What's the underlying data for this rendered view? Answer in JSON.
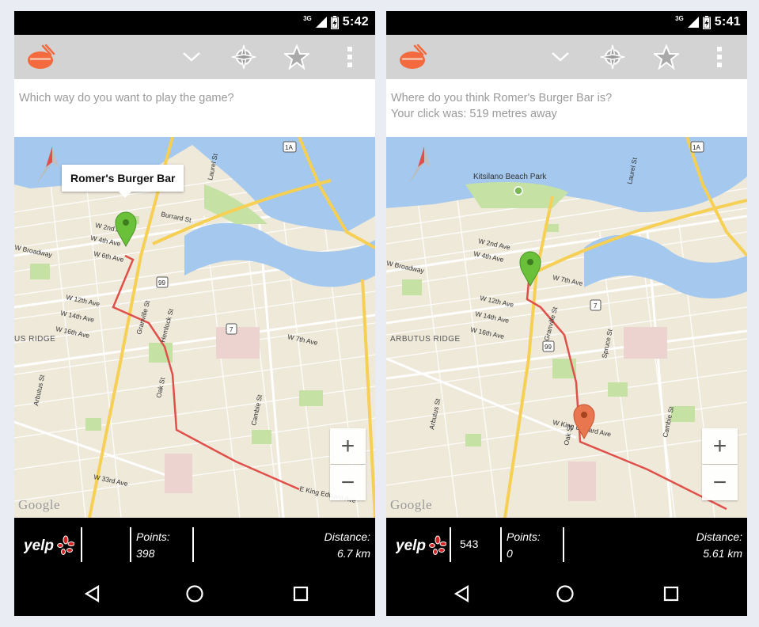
{
  "left": {
    "status": {
      "network": "3G",
      "time": "5:42"
    },
    "prompt": {
      "line1": "Which way do you want to play the game?",
      "line2": ""
    },
    "map": {
      "popup": "Romer's Burger Bar",
      "streets": [
        "W 2nd Ave",
        "W 4th Ave",
        "W 6th Ave",
        "W Broadway",
        "W 12th Ave",
        "W 14th Ave",
        "W 16th Ave",
        "Granville St",
        "Hemlock St",
        "W 7th Ave",
        "W 33rd Ave",
        "E King Edward Ave",
        "Cambie St",
        "Oak St",
        "Burrard St",
        "Arbutus St",
        "Laurel St"
      ],
      "area": "US RIDGE",
      "highways": [
        "99",
        "7",
        "1A"
      ],
      "google": "Google"
    },
    "bottom": {
      "rating": "",
      "points_label": "Points:",
      "points_value": "398",
      "distance_label": "Distance:",
      "distance_value": "6.7 km"
    }
  },
  "right": {
    "status": {
      "network": "3G",
      "time": "5:41"
    },
    "prompt": {
      "line1": "Where do you think Romer's Burger Bar is?",
      "line2": "Your click was: 519 metres away"
    },
    "map": {
      "park": "Kitsilano Beach Park",
      "streets": [
        "W 2nd Ave",
        "W 4th Ave",
        "W Broadway",
        "W 7th Ave",
        "W 12th Ave",
        "W 14th Ave",
        "W 16th Ave",
        "Granville St",
        "Spruce St",
        "W King Edward Ave",
        "Cambie St",
        "Oak St",
        "Arbutus St",
        "Laurel St"
      ],
      "area": "ARBUTUS RIDGE",
      "highways": [
        "99",
        "7",
        "1A"
      ],
      "google": "Google"
    },
    "bottom": {
      "rating": "543",
      "points_label": "Points:",
      "points_value": "0",
      "distance_label": "Distance:",
      "distance_value": "5.61 km"
    }
  },
  "icons": [
    "app-logo-icon",
    "chevron-down-icon",
    "compass-icon",
    "star-icon",
    "overflow-menu-icon",
    "back-icon",
    "home-icon",
    "recents-icon",
    "yelp-logo-icon",
    "signal-icon",
    "battery-icon",
    "map-pin-icon",
    "map-compass-icon"
  ],
  "colors": {
    "actionbar": "#d3d3d3",
    "logo_orange": "#f26a3d",
    "pin_green": "#6bc03a",
    "pin_orange": "#e8764f",
    "route_red": "#e0504a",
    "water": "#a4c8ee",
    "road_yellow": "#f6cf55",
    "park": "#c5e2a4"
  },
  "zoom": {
    "in": "+",
    "out": "−"
  }
}
